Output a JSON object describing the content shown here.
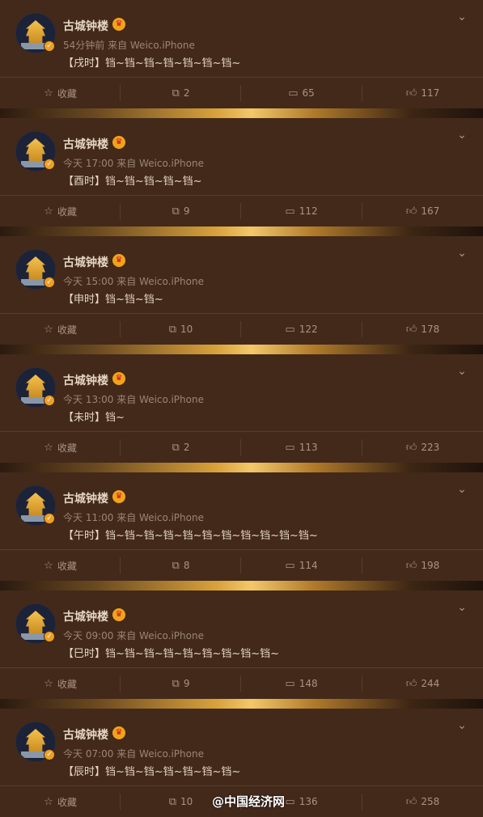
{
  "colors": {
    "background": "#43291a",
    "name": "#e6d6c4",
    "meta": "#9a8672",
    "vip": "#f2a31a"
  },
  "posts": [
    {
      "name": "古城钟楼",
      "meta": "54分钟前 来自 Weico.iPhone",
      "text": "【戌时】铛~铛~铛~铛~铛~铛~铛~",
      "fav": "收藏",
      "reposts": "2",
      "comments": "65",
      "likes": "117"
    },
    {
      "name": "古城钟楼",
      "meta": "今天 17:00 来自 Weico.iPhone",
      "text": "【酉时】铛~铛~铛~铛~铛~",
      "fav": "收藏",
      "reposts": "9",
      "comments": "112",
      "likes": "167"
    },
    {
      "name": "古城钟楼",
      "meta": "今天 15:00 来自 Weico.iPhone",
      "text": "【申时】铛~铛~铛~",
      "fav": "收藏",
      "reposts": "10",
      "comments": "122",
      "likes": "178"
    },
    {
      "name": "古城钟楼",
      "meta": "今天 13:00 来自 Weico.iPhone",
      "text": "【未时】铛~",
      "fav": "收藏",
      "reposts": "2",
      "comments": "113",
      "likes": "223"
    },
    {
      "name": "古城钟楼",
      "meta": "今天 11:00 来自 Weico.iPhone",
      "text": "【午时】铛~铛~铛~铛~铛~铛~铛~铛~铛~铛~铛~",
      "fav": "收藏",
      "reposts": "8",
      "comments": "114",
      "likes": "198"
    },
    {
      "name": "古城钟楼",
      "meta": "今天 09:00 来自 Weico.iPhone",
      "text": "【巳时】铛~铛~铛~铛~铛~铛~铛~铛~铛~",
      "fav": "收藏",
      "reposts": "9",
      "comments": "148",
      "likes": "244"
    },
    {
      "name": "古城钟楼",
      "meta": "今天 07:00 来自 Weico.iPhone",
      "text": "【辰时】铛~铛~铛~铛~铛~铛~铛~",
      "fav": "收藏",
      "reposts": "10",
      "comments": "136",
      "likes": "258"
    }
  ],
  "watermark": "@中国经济网"
}
